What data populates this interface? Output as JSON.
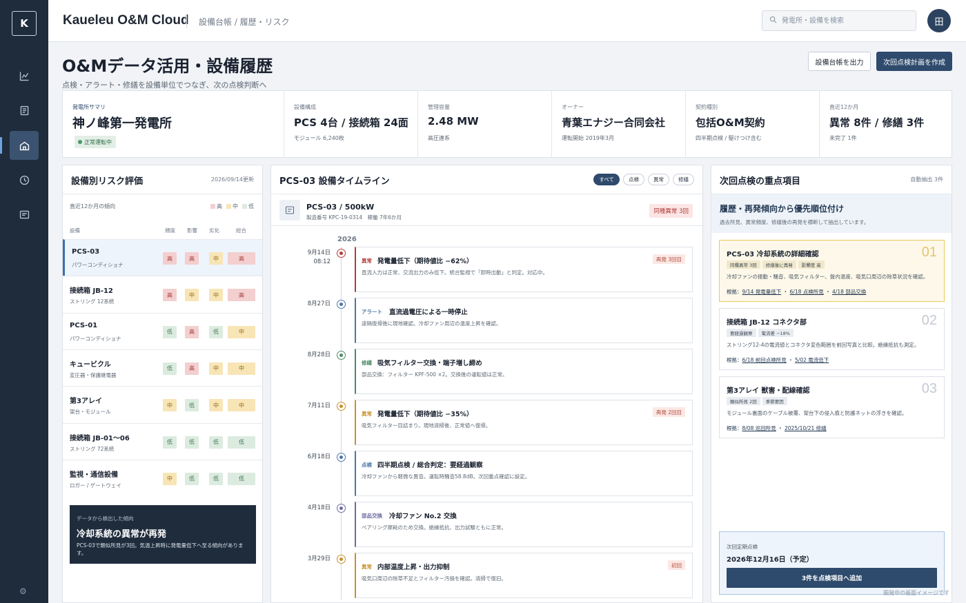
{
  "app": {
    "logo": "K",
    "brand": "Kaueleu O&M Cloud",
    "breadcrumb": "設備台帳 / 履歴・リスク",
    "search_placeholder": "発電所・設備を検索",
    "avatar": "田"
  },
  "sidebar": {
    "items": [
      {
        "icon": "chart-icon"
      },
      {
        "icon": "document-icon"
      },
      {
        "icon": "plant-icon",
        "active": true
      },
      {
        "icon": "clock-icon"
      },
      {
        "icon": "report-icon"
      }
    ],
    "settings_glyph": "⚙"
  },
  "page": {
    "title": "O&Mデータ活用・設備履歴",
    "subtitle": "点検・アラート・修繕を設備単位でつなぎ、次の点検判断へ",
    "export_button": "設備台帳を出力",
    "plan_button": "次回点検計画を作成"
  },
  "summary": {
    "plant_label": "発電所サマリ",
    "plant_name": "神ノ峰第一発電所",
    "status": "正常運転中",
    "cells": [
      {
        "label": "設備構成",
        "value": "PCS 4台 / 接続箱 24面",
        "note": "モジュール 6,240枚"
      },
      {
        "label": "管理容量",
        "value": "2.48 MW",
        "note": "高圧連系"
      },
      {
        "label": "オーナー",
        "value": "青葉エナジー合同会社",
        "note": "運転開始 2019年3月"
      },
      {
        "label": "契約種別",
        "value": "包括O&M契約",
        "note": "四半期点検 / 駆けつけ含む"
      },
      {
        "label": "直近12か月",
        "value": "異常 8件 / 修繕 3件",
        "note": "未完了 1件"
      }
    ]
  },
  "risk": {
    "title": "設備別リスク評価",
    "updated": "2026/09/14更新",
    "trend_label": "直近12か月の傾向",
    "legend": {
      "high": "高",
      "mid": "中",
      "low": "低"
    },
    "columns": {
      "asset": "設備",
      "frequency": "頻度",
      "impact": "影響",
      "degradation": "劣化",
      "total": "総合"
    },
    "rows": [
      {
        "name": "PCS-03",
        "sub": "パワーコンディショナ",
        "frequency": "高",
        "impact": "高",
        "degradation": "中",
        "total": "高",
        "active": true
      },
      {
        "name": "接続箱 JB-12",
        "sub": "ストリング 12系統",
        "frequency": "高",
        "impact": "中",
        "degradation": "中",
        "total": "高"
      },
      {
        "name": "PCS-01",
        "sub": "パワーコンディショナ",
        "frequency": "低",
        "impact": "高",
        "degradation": "低",
        "total": "中"
      },
      {
        "name": "キュービクル",
        "sub": "変圧器・保護継電器",
        "frequency": "低",
        "impact": "高",
        "degradation": "中",
        "total": "中"
      },
      {
        "name": "第3アレイ",
        "sub": "架台・モジュール",
        "frequency": "中",
        "impact": "低",
        "degradation": "中",
        "total": "中"
      },
      {
        "name": "接続箱 JB-01〜06",
        "sub": "ストリング 72系統",
        "frequency": "低",
        "impact": "低",
        "degradation": "低",
        "total": "低"
      },
      {
        "name": "監視・通信設備",
        "sub": "ロガー / ゲートウェイ",
        "frequency": "中",
        "impact": "低",
        "degradation": "低",
        "total": "低"
      }
    ],
    "insight": {
      "kicker": "データから検出した傾向",
      "title": "冷却系統の異常が再発",
      "desc": "PCS-03で類似所見が3回。気温上昇時に発電量低下へ至る傾向があります。"
    }
  },
  "timeline": {
    "title": "PCS-03 設備タイムライン",
    "filters": [
      "すべて",
      "点検",
      "異常",
      "修繕"
    ],
    "asset_title": "PCS-03 / 500kW",
    "asset_sub": "製造番号 KPC-19-0314　稼働 7年6か月",
    "asset_badge": "同種異常 3回",
    "year": "2026",
    "events": [
      {
        "date": "9月14日",
        "time": "08:12",
        "type": "異常",
        "kind": "anomaly",
        "title": "発電量低下（期待値比 −62%）",
        "desc": "直流入力は正常、交流出力のみ低下。統合監視で「即時出動」と判定。対応中。",
        "tag": "再発 3回目"
      },
      {
        "date": "8月27日",
        "time": "",
        "type": "アラート",
        "kind": "alert",
        "title": "直流過電圧による一時停止",
        "desc": "遠隔復帰後に現地確認。冷却ファン周辺の温度上昇を確認。",
        "tag": ""
      },
      {
        "date": "8月28日",
        "time": "",
        "type": "修繕",
        "kind": "repair",
        "title": "吸気フィルター交換・端子増し締め",
        "desc": "部品交換：フィルター KPF-500 ×2。交換後の運転値は正常。",
        "tag": ""
      },
      {
        "date": "7月11日",
        "time": "",
        "type": "異常",
        "kind": "warn",
        "title": "発電量低下（期待値比 −35%）",
        "desc": "吸気フィルター目詰まり。現地清掃後、正常値へ復帰。",
        "tag": "再発 2回目"
      },
      {
        "date": "6月18日",
        "time": "",
        "type": "点検",
        "kind": "alert",
        "title": "四半期点検 / 総合判定：要経過観察",
        "desc": "冷却ファンから軽微な異音。運転時騒音58.8dB。次回重点確認に設定。",
        "tag": ""
      },
      {
        "date": "4月18日",
        "time": "",
        "type": "部品交換",
        "kind": "parts",
        "title": "冷却ファン No.2 交換",
        "desc": "ベアリング摩耗のため交換。絶縁抵抗、出力試験ともに正常。",
        "tag": ""
      },
      {
        "date": "3月29日",
        "time": "",
        "type": "異常",
        "kind": "warn",
        "title": "内部温度上昇・出力抑制",
        "desc": "吸気口周辺の除草不足とフィルター汚損を確認。清掃で復旧。",
        "tag": "初回"
      }
    ]
  },
  "next": {
    "title": "次回点検の重点項目",
    "meta": "自動抽出 3件",
    "intro_title": "履歴・再発傾向から優先順位付け",
    "intro_desc": "過去所見、異常頻度、修繕後の再発を横断して抽出しています。",
    "refs_label": "根拠：",
    "items": [
      {
        "num": "01",
        "title": "PCS-03 冷却系統の詳細確認",
        "tags": [
          "同種異常 3回",
          "修繕後に再発",
          "影響度 高"
        ],
        "desc": "冷却ファンの振動・騒音、吸気フィルター、盤内温度、吸気口周辺の除草状況を確認。",
        "refs": [
          "9/14 発電量低下",
          "6/18 点検所見",
          "4/18 部品交換"
        ]
      },
      {
        "num": "02",
        "title": "接続箱 JB-12 コネクタ部",
        "tags": [
          "要経過観察",
          "電流差 −18%"
        ],
        "desc": "ストリング12-4の電流値とコネクタ変色範囲を前回写真と比較。絶縁抵抗も測定。",
        "refs": [
          "6/18 前回点検所見",
          "5/02 電流低下"
        ]
      },
      {
        "num": "03",
        "title": "第3アレイ 獣害・配線確認",
        "tags": [
          "類似所見 2回",
          "季節要因"
        ],
        "desc": "モジュール裏面のケーブル被覆、架台下の侵入痕と防護ネットの浮きを確認。",
        "refs": [
          "8/08 巡回所見",
          "2025/10/21 修繕"
        ]
      }
    ],
    "plan_label": "次回定期点検",
    "plan_date": "2026年12月16日（予定）",
    "plan_button": "3件を点検項目へ追加"
  },
  "footer": {
    "watermark": "開発中の画面イメージです"
  },
  "colors": {
    "anomaly": "#b33a3a",
    "alert": "#4a76a8",
    "repair": "#4b8a66",
    "warn": "#c8902a",
    "parts": "#6b6aa0",
    "high": "#f3cfcf",
    "mid": "#f8e5b6",
    "low": "#dcebdf"
  }
}
